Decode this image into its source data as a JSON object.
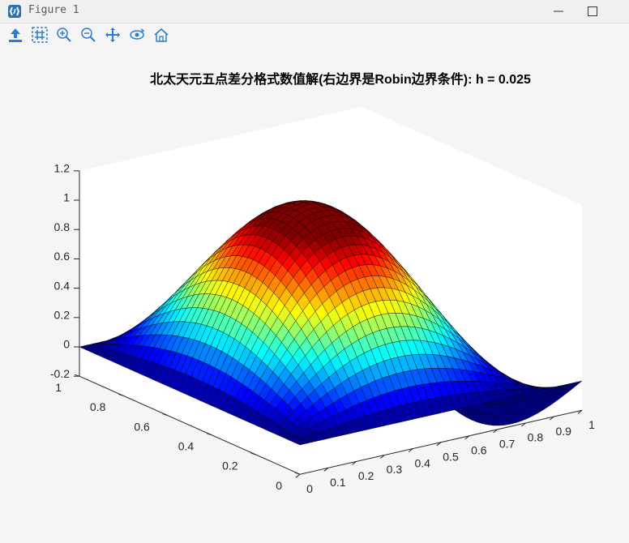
{
  "window": {
    "title": "Figure 1",
    "logo_icon": "matlab-figure-logo",
    "controls": [
      "minimize-icon",
      "maximize-icon"
    ]
  },
  "toolbar": {
    "tools": [
      {
        "name": "save-figure-icon"
      },
      {
        "name": "data-cursor-icon"
      },
      {
        "name": "zoom-in-icon"
      },
      {
        "name": "zoom-out-icon"
      },
      {
        "name": "pan-icon"
      },
      {
        "name": "rotate-3d-icon"
      },
      {
        "name": "home-view-icon"
      }
    ],
    "icon_color": "#2a7fd4"
  },
  "chart_data": {
    "type": "surface",
    "title": "北太天元五点差分格式数值解(右边界是Robin边界条件): h = 0.025",
    "xlabel": "",
    "ylabel": "",
    "zlabel": "",
    "xlim": [
      0,
      1
    ],
    "ylim": [
      0,
      1
    ],
    "zlim": [
      -0.2,
      1.2
    ],
    "x_ticks": [
      "0",
      "0.1",
      "0.2",
      "0.3",
      "0.4",
      "0.5",
      "0.6",
      "0.7",
      "0.8",
      "0.9",
      "1"
    ],
    "y_ticks": [
      "0",
      "0.2",
      "0.4",
      "0.6",
      "0.8",
      "1"
    ],
    "z_ticks": [
      "-0.2",
      "0",
      "0.2",
      "0.4",
      "0.6",
      "0.8",
      "1",
      "1.2"
    ],
    "grid_step": 0.025,
    "colormap": "jet",
    "surface_peak": 1.0,
    "surface_peak_xy": [
      0.55,
      0.5
    ],
    "surface_edge_value": 0,
    "grid": false
  }
}
